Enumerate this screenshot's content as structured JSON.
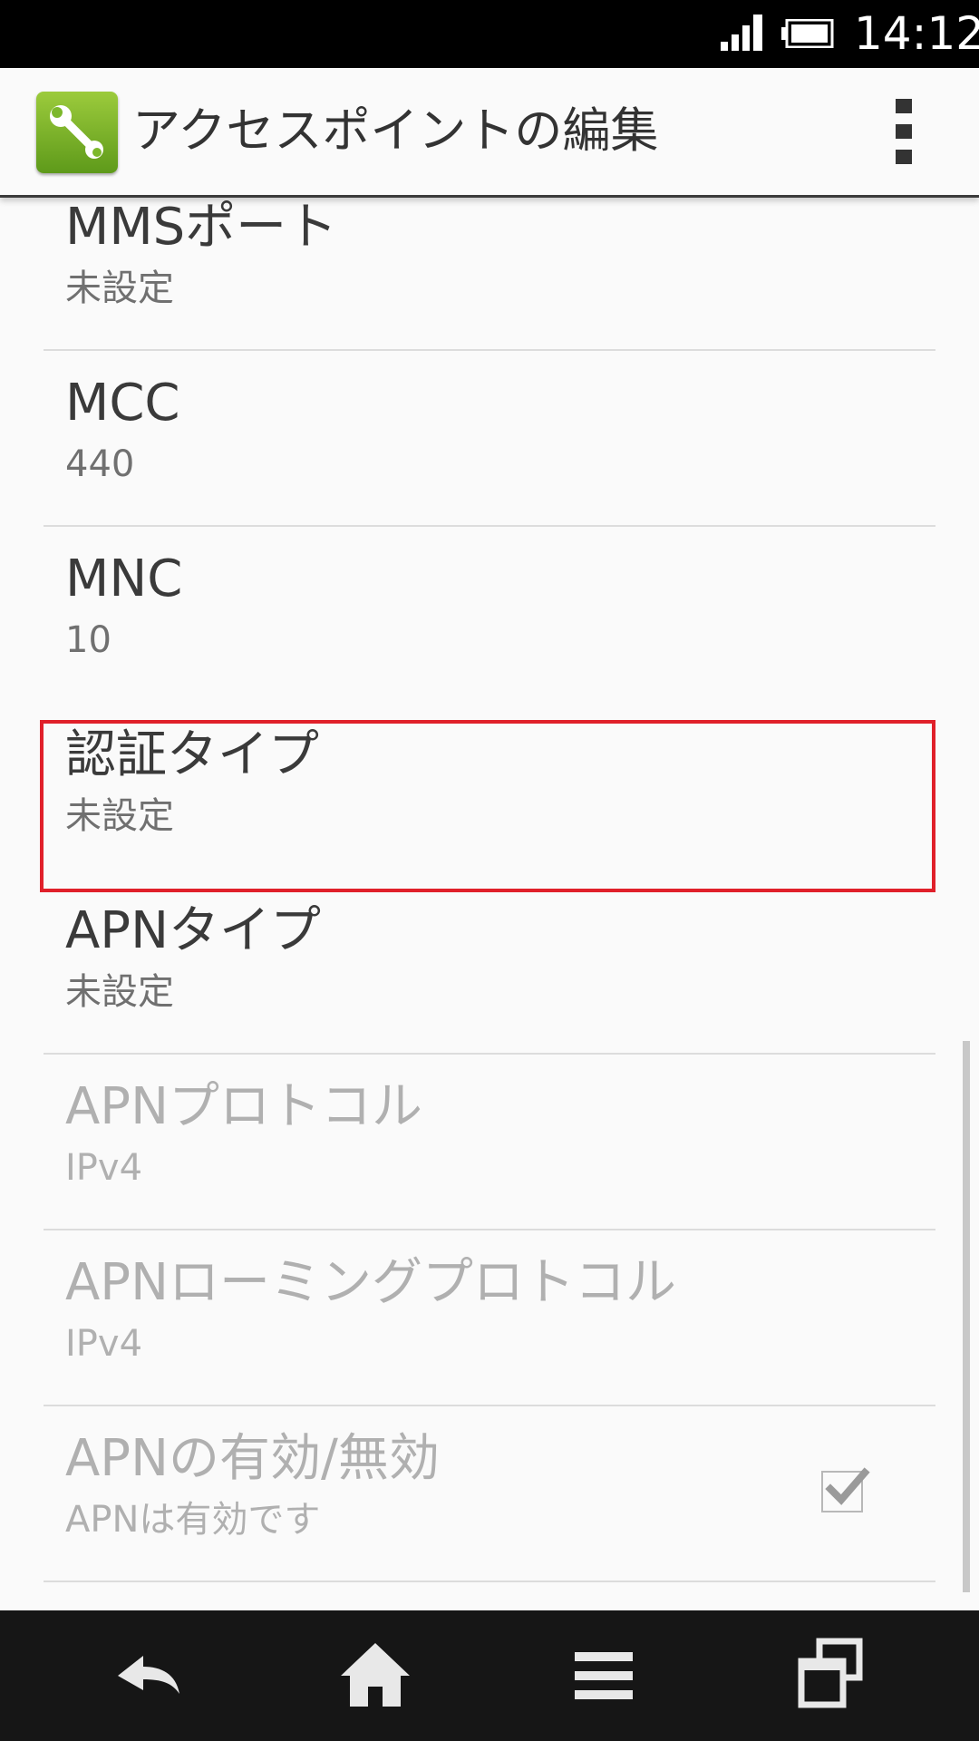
{
  "status_bar": {
    "time": "14:12",
    "icons": [
      "signal-icon",
      "battery-icon"
    ]
  },
  "action_bar": {
    "app_icon": "wrench-icon",
    "title": "アクセスポイントの編集",
    "overflow_icon": "overflow-menu-icon"
  },
  "preferences": [
    {
      "title": "MMSポート",
      "summary": "未設定",
      "enabled": true
    },
    {
      "title": "MCC",
      "summary": "440",
      "enabled": true
    },
    {
      "title": "MNC",
      "summary": "10",
      "enabled": true
    },
    {
      "title": "認証タイプ",
      "summary": "未設定",
      "enabled": true,
      "highlighted": true
    },
    {
      "title": "APNタイプ",
      "summary": "未設定",
      "enabled": true
    },
    {
      "title": "APNプロトコル",
      "summary": "IPv4",
      "enabled": false
    },
    {
      "title": "APNローミングプロトコル",
      "summary": "IPv4",
      "enabled": false
    },
    {
      "title": "APNの有効/無効",
      "summary": "APNは有効です",
      "enabled": false,
      "checked": true
    }
  ],
  "colors": {
    "highlight": "#e0202a",
    "app_icon": "#7cb82b",
    "nav_bar": "#161616"
  },
  "nav_bar": {
    "icons": [
      "back-icon",
      "home-icon",
      "menu-icon",
      "recent-apps-icon"
    ]
  }
}
